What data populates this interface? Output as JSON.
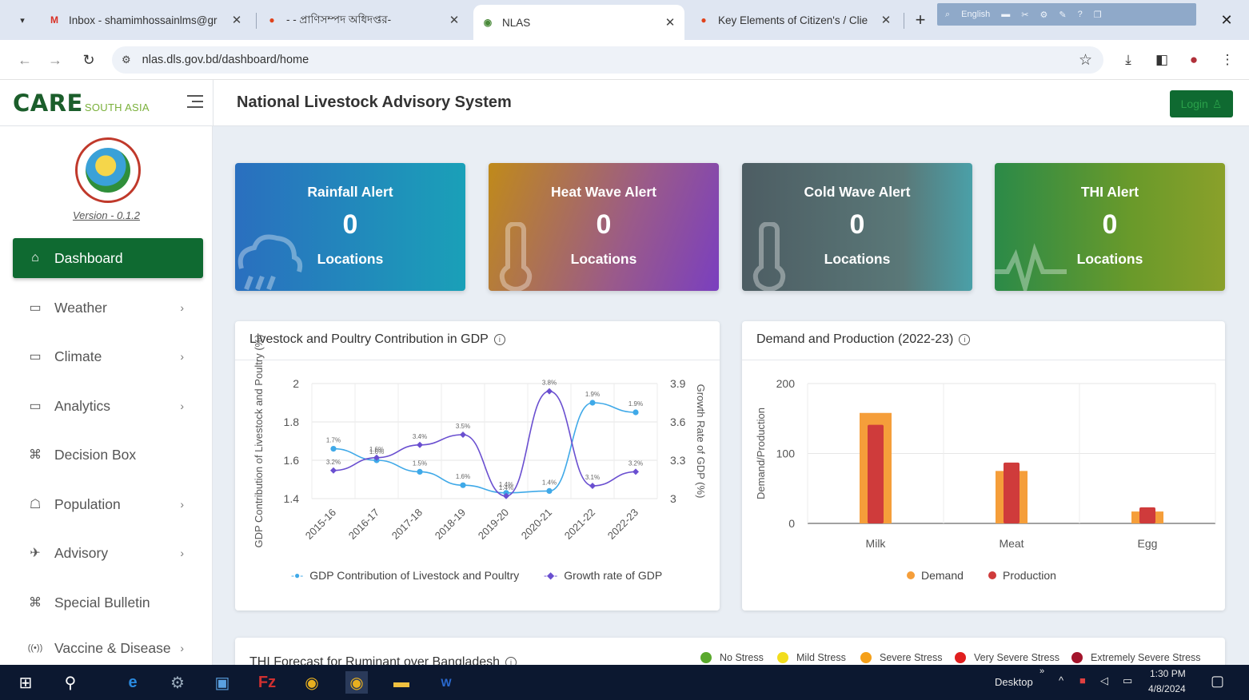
{
  "browser": {
    "tabs": [
      {
        "title": "Inbox - shamimhossainlms@gr",
        "favicon": "M"
      },
      {
        "title": "- - প্রাণিসম্পদ অধিদপ্তর-",
        "favicon": "●"
      },
      {
        "title": "NLAS",
        "favicon": "◉"
      },
      {
        "title": "Key Elements of Citizen's / Clie",
        "favicon": "●"
      }
    ],
    "lang_label": "English",
    "url": "nlas.dls.gov.bd/dashboard/home"
  },
  "header": {
    "brand_main": "CARE",
    "brand_sub": "SOUTH ASIA",
    "title": "National Livestock Advisory System",
    "login_label": "Login"
  },
  "sidebar": {
    "version": "Version - 0.1.2",
    "items": [
      {
        "label": "Dashboard",
        "icon": "home-icon"
      },
      {
        "label": "Weather",
        "icon": "calendar-icon"
      },
      {
        "label": "Climate",
        "icon": "calendar-icon"
      },
      {
        "label": "Analytics",
        "icon": "calendar-icon"
      },
      {
        "label": "Decision Box",
        "icon": "command-icon"
      },
      {
        "label": "Population",
        "icon": "chat-icon"
      },
      {
        "label": "Advisory",
        "icon": "dove-icon"
      },
      {
        "label": "Special Bulletin",
        "icon": "command-icon"
      },
      {
        "label": "Vaccine & Disease",
        "icon": "broadcast-icon"
      }
    ]
  },
  "alerts": [
    {
      "title": "Rainfall Alert",
      "count": "0",
      "sub": "Locations"
    },
    {
      "title": "Heat Wave Alert",
      "count": "0",
      "sub": "Locations"
    },
    {
      "title": "Cold Wave Alert",
      "count": "0",
      "sub": "Locations"
    },
    {
      "title": "THI Alert",
      "count": "0",
      "sub": "Locations"
    }
  ],
  "gdp_card": {
    "title": "Livestock and Poultry Contribution in GDP"
  },
  "dp_card": {
    "title": "Demand and Production (2022-23)"
  },
  "thi_card": {
    "title": "THI Forecast for Ruminant over Bangladesh",
    "legend": [
      {
        "label": "No Stress",
        "color": "#5aa92d"
      },
      {
        "label": "Mild Stress",
        "color": "#f2dd1d"
      },
      {
        "label": "Severe Stress",
        "color": "#f5a01a"
      },
      {
        "label": "Very Severe Stress",
        "color": "#e01f1f"
      },
      {
        "label": "Extremely Severe Stress",
        "color": "#a3142b"
      }
    ]
  },
  "chart_data": [
    {
      "type": "line",
      "categories": [
        "2015-16",
        "2016-17",
        "2017-18",
        "2018-19",
        "2019-20",
        "2020-21",
        "2021-22",
        "2022-23"
      ],
      "ylabel": "GDP Contribution of Livestock and Poultry (%)",
      "y2label": "Growth Rate of GDP (%)",
      "ylim": [
        1.4,
        2
      ],
      "y_ticks": [
        "1.4",
        "1.6",
        "1.8",
        "2"
      ],
      "y2lim": [
        3,
        3.9
      ],
      "y2_ticks": [
        "3",
        "3.3",
        "3.6",
        "3.9"
      ],
      "series": [
        {
          "name": "GDP Contribution of Livestock and Poultry",
          "axis": "left",
          "color": "#3fa9e8",
          "values": [
            1.66,
            1.6,
            1.54,
            1.47,
            1.43,
            1.44,
            1.9,
            1.85
          ],
          "labels": [
            "1.7%",
            "1.6%",
            "1.5%",
            "1.6%",
            "1.4%",
            "1.4%",
            "1.9%",
            "1.9%"
          ]
        },
        {
          "name": "Growth rate of GDP",
          "axis": "right",
          "color": "#6a4fd0",
          "values": [
            3.22,
            3.32,
            3.42,
            3.5,
            3.02,
            3.84,
            3.1,
            3.21
          ],
          "labels": [
            "3.2%",
            "1.6%",
            "3.4%",
            "3.5%",
            "1.4%",
            "3.8%",
            "3.1%",
            "3.2%"
          ]
        }
      ],
      "legend": "bottom",
      "grid": true
    },
    {
      "type": "bar",
      "categories": [
        "Milk",
        "Meat",
        "Egg"
      ],
      "ylabel": "Demand/Production",
      "ylim": [
        0,
        200
      ],
      "y_ticks": [
        "0",
        "100",
        "200"
      ],
      "series": [
        {
          "name": "Demand",
          "color": "#f59e3a",
          "values": [
            158,
            75,
            17
          ]
        },
        {
          "name": "Production",
          "color": "#cf3b3b",
          "values": [
            141,
            87,
            23
          ]
        }
      ],
      "legend": "bottom",
      "grid": true
    }
  ],
  "taskbar": {
    "desktop_label": "Desktop",
    "time": "1:30 PM",
    "date": "4/8/2024"
  }
}
